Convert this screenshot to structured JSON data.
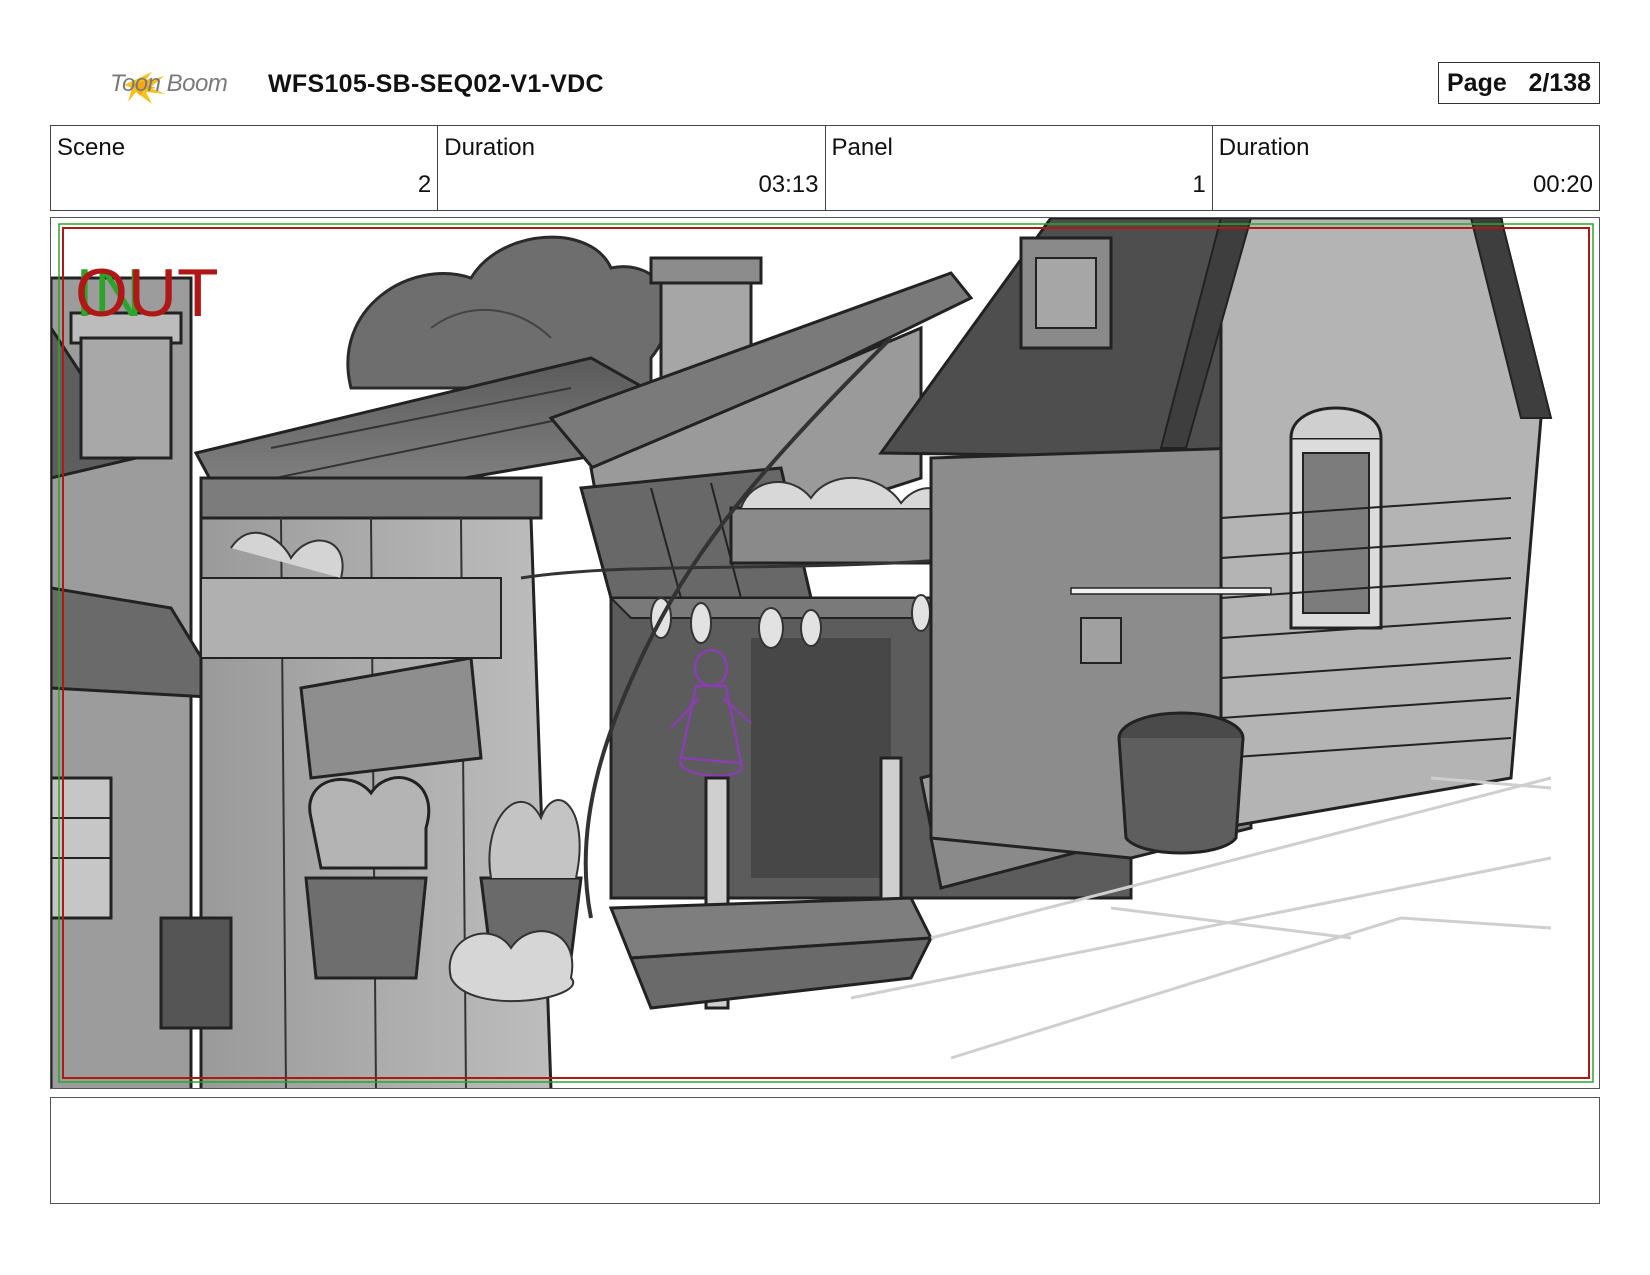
{
  "header": {
    "logo_text": "Toon Boom",
    "document_title": "WFS105-SB-SEQ02-V1-VDC",
    "page_label": "Page",
    "page_number": "2/138"
  },
  "info": {
    "scene_label": "Scene",
    "scene_value": "2",
    "scene_duration_label": "Duration",
    "scene_duration_value": "03:13",
    "panel_label": "Panel",
    "panel_value": "1",
    "panel_duration_label": "Duration",
    "panel_duration_value": "00:20"
  },
  "panel": {
    "in_marker": "IN",
    "out_marker": "OUT",
    "in_color": "#2aa52a",
    "out_color": "#b01818",
    "frame_line_color": "#b01818",
    "character_line_color": "#8a3fb0"
  },
  "notes": {
    "text": ""
  }
}
